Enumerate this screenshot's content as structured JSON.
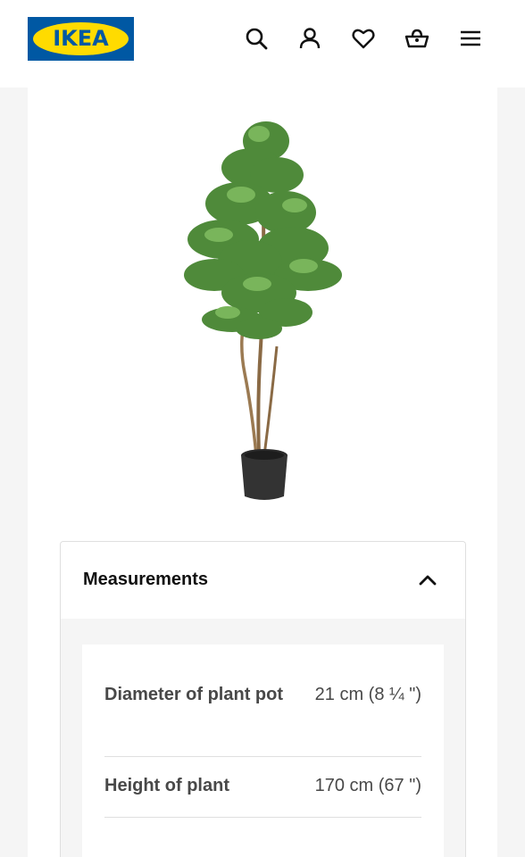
{
  "header": {
    "logo_text": "IKEA",
    "icons": [
      "search-icon",
      "account-icon",
      "favourites-icon",
      "basket-icon",
      "menu-icon"
    ]
  },
  "product": {
    "image": "artificial-potted-plant"
  },
  "measurements": {
    "title": "Measurements",
    "expanded": true,
    "rows": [
      {
        "label": "Diameter of plant pot",
        "value": "21 cm (8 ¼ \")"
      },
      {
        "label": "Height of plant",
        "value": "170 cm (67 \")"
      }
    ]
  },
  "colors": {
    "ikea_blue": "#0058a3",
    "ikea_yellow": "#ffdb00",
    "text_dark": "#111111",
    "text_grey": "#484848",
    "divider": "#dfdfdf",
    "background": "#f5f5f5"
  }
}
